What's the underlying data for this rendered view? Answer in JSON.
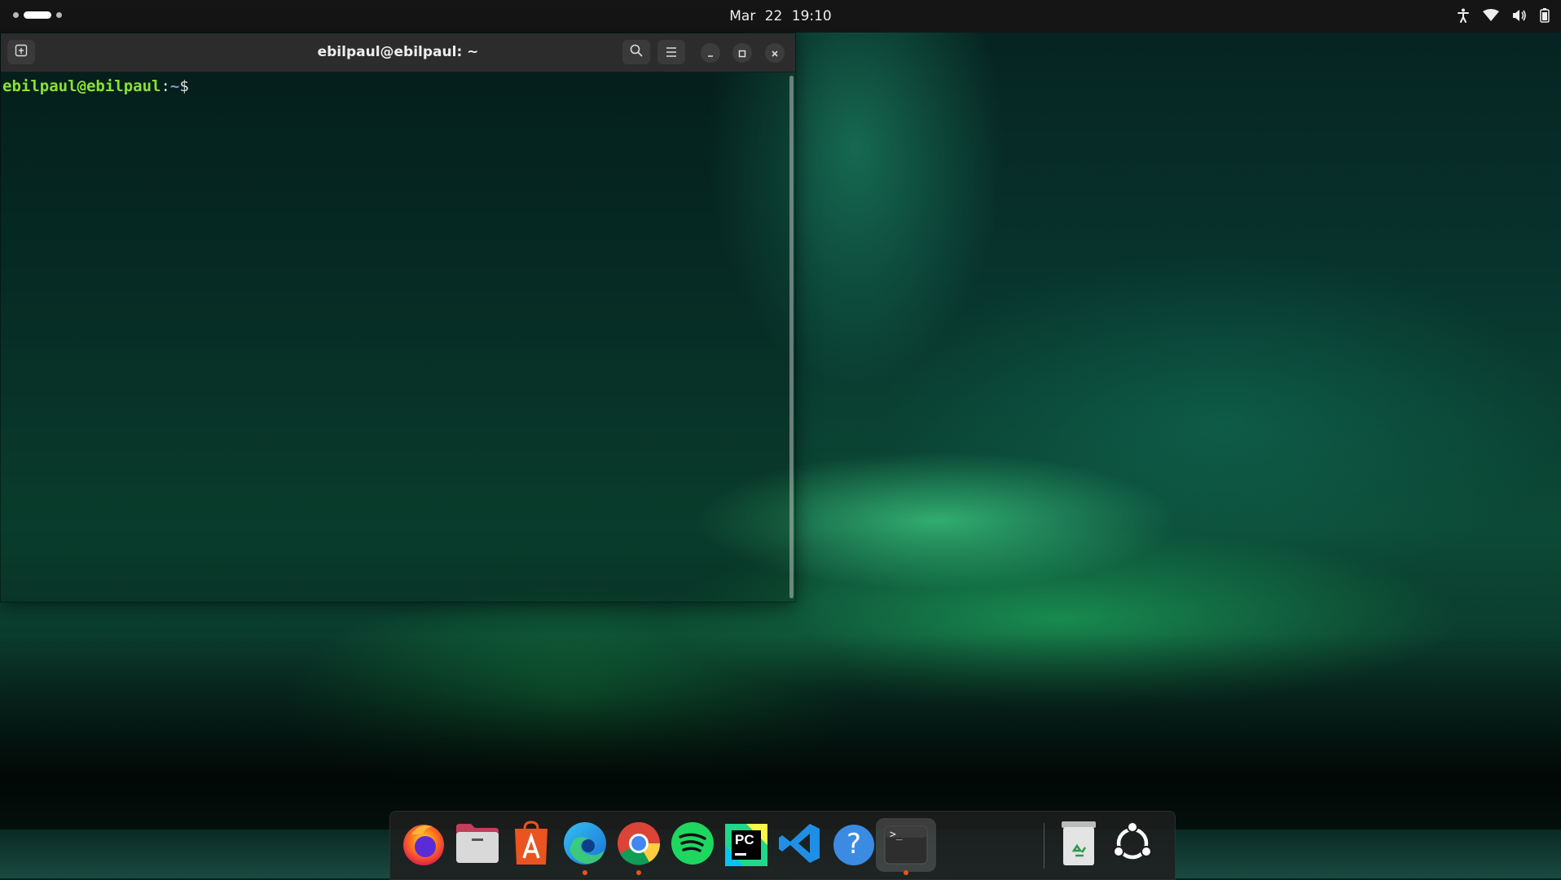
{
  "topbar": {
    "clock": "Mar 22  19:10",
    "icons": [
      "accessibility-icon",
      "wifi-icon",
      "volume-icon",
      "battery-icon"
    ]
  },
  "terminal": {
    "title": "ebilpaul@ebilpaul: ~",
    "prompt_user": "ebilpaul@ebilpaul",
    "prompt_colon": ":",
    "prompt_path": "~",
    "prompt_sign": "$"
  },
  "dock": {
    "items": [
      {
        "name": "Firefox",
        "icon": "firefox-icon",
        "running": false
      },
      {
        "name": "Files",
        "icon": "files-icon",
        "running": false
      },
      {
        "name": "App Center",
        "icon": "app-center-icon",
        "running": false
      },
      {
        "name": "Microsoft Edge",
        "icon": "edge-icon",
        "running": true
      },
      {
        "name": "Google Chrome",
        "icon": "chrome-icon",
        "running": true
      },
      {
        "name": "Spotify",
        "icon": "spotify-icon",
        "running": false
      },
      {
        "name": "PyCharm",
        "icon": "pycharm-icon",
        "running": false
      },
      {
        "name": "Visual Studio Code",
        "icon": "vscode-icon",
        "running": false
      },
      {
        "name": "Help",
        "icon": "help-icon",
        "running": false
      },
      {
        "name": "Terminal",
        "icon": "terminal-icon",
        "running": true
      },
      {
        "name": "Trash",
        "icon": "trash-icon",
        "running": false
      },
      {
        "name": "Show Apps",
        "icon": "show-apps-icon",
        "running": false
      }
    ],
    "terminal_glyph": ">_",
    "pycharm_glyph": "PC",
    "help_glyph": "?"
  },
  "colors": {
    "prompt_user": "#8ae234",
    "prompt_path": "#729fcf",
    "accent": "#e95420"
  }
}
